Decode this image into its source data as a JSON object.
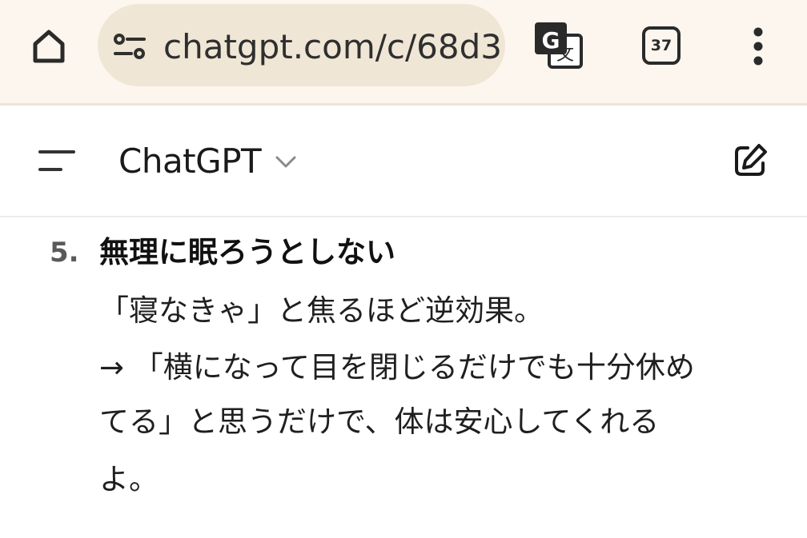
{
  "browser": {
    "url": "chatgpt.com/c/68d3",
    "tab_count": "37",
    "icons": {
      "home": "home-icon",
      "site_settings": "tune-icon",
      "translate": "translate-icon",
      "tabs": "tab-switcher-icon",
      "menu": "more-vert-icon"
    },
    "colors": {
      "toolbar_bg": "#fdf6ee",
      "urlbar_bg": "#efe6d5"
    }
  },
  "app": {
    "title": "ChatGPT",
    "icons": {
      "sidebar": "sidebar-menu-icon",
      "model_dropdown": "chevron-down-icon",
      "new_chat": "edit-icon"
    }
  },
  "message": {
    "item_number": "5.",
    "heading": "無理に眠ろうとしない",
    "lines": [
      "「寝なきゃ」と焦るほど逆効果。",
      "→ 「横になって目を閉じるだけでも十分休め",
      "てる」と思うだけで、体は安心してくれる",
      "よ。"
    ]
  }
}
